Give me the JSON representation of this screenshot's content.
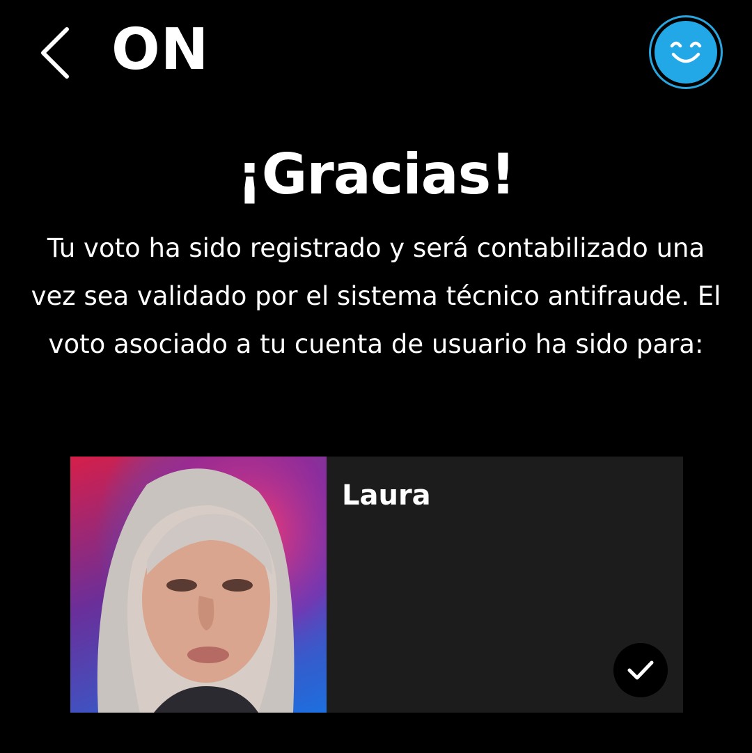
{
  "header": {
    "back_icon": "chevron-left-icon",
    "brand": "ON",
    "avatar_icon": "smiley-face-icon",
    "accent_color": "#22a8e6"
  },
  "main": {
    "title": "¡Gracias!",
    "message": "Tu voto ha sido registrado y será contabilizado una vez sea validado por el sistema técnico antifraude. El voto asociado a tu cuenta de usuario ha sido para:"
  },
  "vote_card": {
    "candidate_name": "Laura",
    "photo_alt": "Laura",
    "selected": true,
    "check_icon": "checkmark-icon"
  }
}
